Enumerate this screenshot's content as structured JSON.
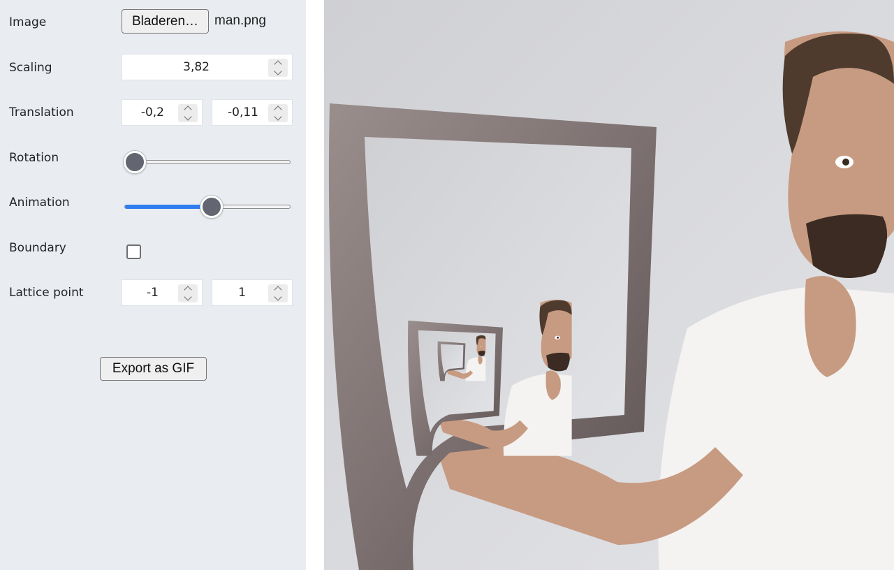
{
  "controls": {
    "image": {
      "label": "Image",
      "button_label": "Bladeren…",
      "file_name": "man.png"
    },
    "scaling": {
      "label": "Scaling",
      "value": "3,82"
    },
    "translation": {
      "label": "Translation",
      "x": "-0,2",
      "y": "-0,11"
    },
    "rotation": {
      "label": "Rotation",
      "level": 0.0
    },
    "animation": {
      "label": "Animation",
      "level": 0.5
    },
    "boundary": {
      "label": "Boundary",
      "checked": false
    },
    "lattice_point": {
      "label": "Lattice point",
      "a": "-1",
      "b": "1"
    },
    "export": {
      "button_label": "Export as GIF"
    }
  },
  "colors": {
    "panel_bg": "#e9edf1",
    "slider_fill": "#2f7df0",
    "slider_thumb": "#636570",
    "canvas_bg": "#d7d8dc"
  }
}
